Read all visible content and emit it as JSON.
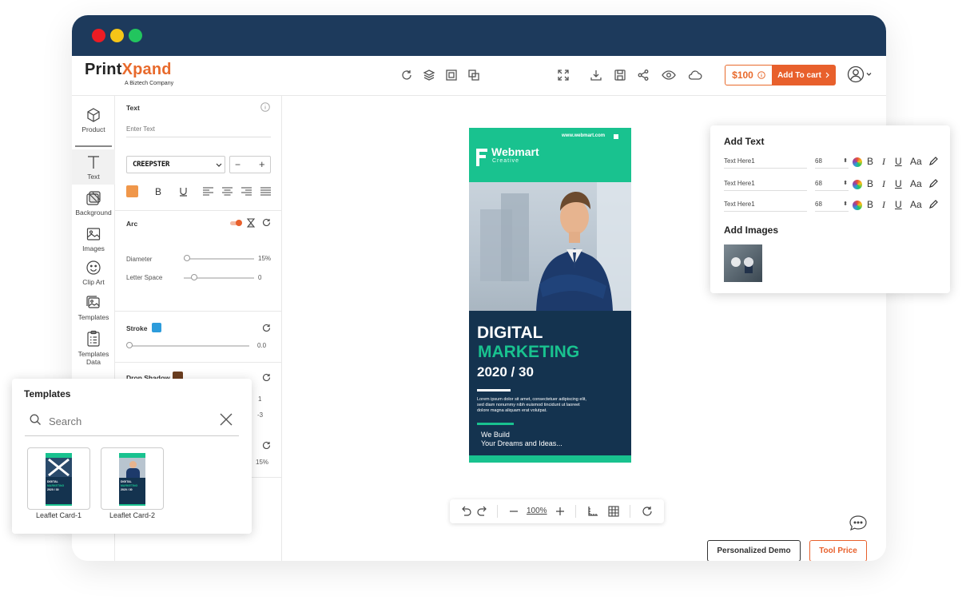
{
  "window": {
    "colors": {
      "titlebar": "#1d3a5c",
      "close": "#ec1c24",
      "minimize": "#f5c518",
      "maximize": "#22c55e",
      "accent": "#e8602c"
    }
  },
  "brand": {
    "logo_part1": "Print",
    "logo_part2": "X",
    "logo_part3": "pand",
    "tagline": "A Biztech Company"
  },
  "toolbar": {
    "left_icons": [
      "refresh-icon",
      "layers-icon",
      "group-icon",
      "duplicate-icon"
    ],
    "right_icons": [
      "fullscreen-icon",
      "download-icon",
      "save-icon",
      "share-icon",
      "preview-icon",
      "cloud-icon"
    ],
    "price": "$100",
    "add_to_cart": "Add To cart"
  },
  "rail": {
    "items": [
      {
        "label": "Product",
        "icon": "cube-icon"
      },
      {
        "label": "Text",
        "icon": "text-icon"
      },
      {
        "label": "Background",
        "icon": "background-icon"
      },
      {
        "label": "Images",
        "icon": "image-icon"
      },
      {
        "label": "Clip Art",
        "icon": "smiley-icon"
      },
      {
        "label": "Templates",
        "icon": "templates-icon"
      },
      {
        "label": "Templates Data",
        "icon": "clipboard-icon"
      }
    ]
  },
  "panel": {
    "text_title": "Text",
    "text_placeholder": "Enter Text",
    "font_name": "CREEPSTER",
    "text_color": "#f0974a",
    "arc_title": "Arc",
    "diameter_label": "Diameter",
    "diameter_value": "15%",
    "diameter_level": 0.05,
    "letter_space_label": "Letter Space",
    "letter_space_value": "0",
    "letter_space_level": 0.15,
    "stroke_title": "Stroke",
    "stroke_color": "#2d9cdb",
    "stroke_value": "0.0",
    "shadow_title": "Drop Shadow",
    "shadow_color": "#6b3d1f",
    "shadow_val1": "1",
    "shadow_val2": "-3",
    "extra_value": "15%"
  },
  "card": {
    "website": "www.webmart.com",
    "brand": "Webmart",
    "brand_sub": "Creative",
    "headline1": "DIGITAL",
    "headline2": "MARKETING",
    "headline3": "2020 / 30",
    "body": "Lorem ipsum dolor sit amet, consectetuer adipiscing elit, sed diam nonummy nibh euismod tincidunt ut laoreet dolore magna aliquam erat volutpat.",
    "tagline1": "We Build",
    "tagline2": "Your Dreams and Ideas..."
  },
  "zoom": {
    "value": "100%"
  },
  "buttons": {
    "demo": "Personalized Demo",
    "tool_price": "Tool Price"
  },
  "add_text": {
    "title": "Add Text",
    "rows": [
      {
        "text": "Text Here1",
        "size": "68"
      },
      {
        "text": "Text Here1",
        "size": "68"
      },
      {
        "text": "Text Here1",
        "size": "68"
      }
    ],
    "format": {
      "bold": "B",
      "italic": "I",
      "underline": "U",
      "case": "Aa"
    },
    "images_title": "Add Images"
  },
  "templates": {
    "title": "Templates",
    "search_placeholder": "Search",
    "items": [
      {
        "label": "Leaflet Card-1"
      },
      {
        "label": "Leaflet Card-2"
      }
    ],
    "mini_headline": "DIGITAL",
    "mini_headline2": "MARKETING",
    "mini_year": "2020 / 30"
  }
}
